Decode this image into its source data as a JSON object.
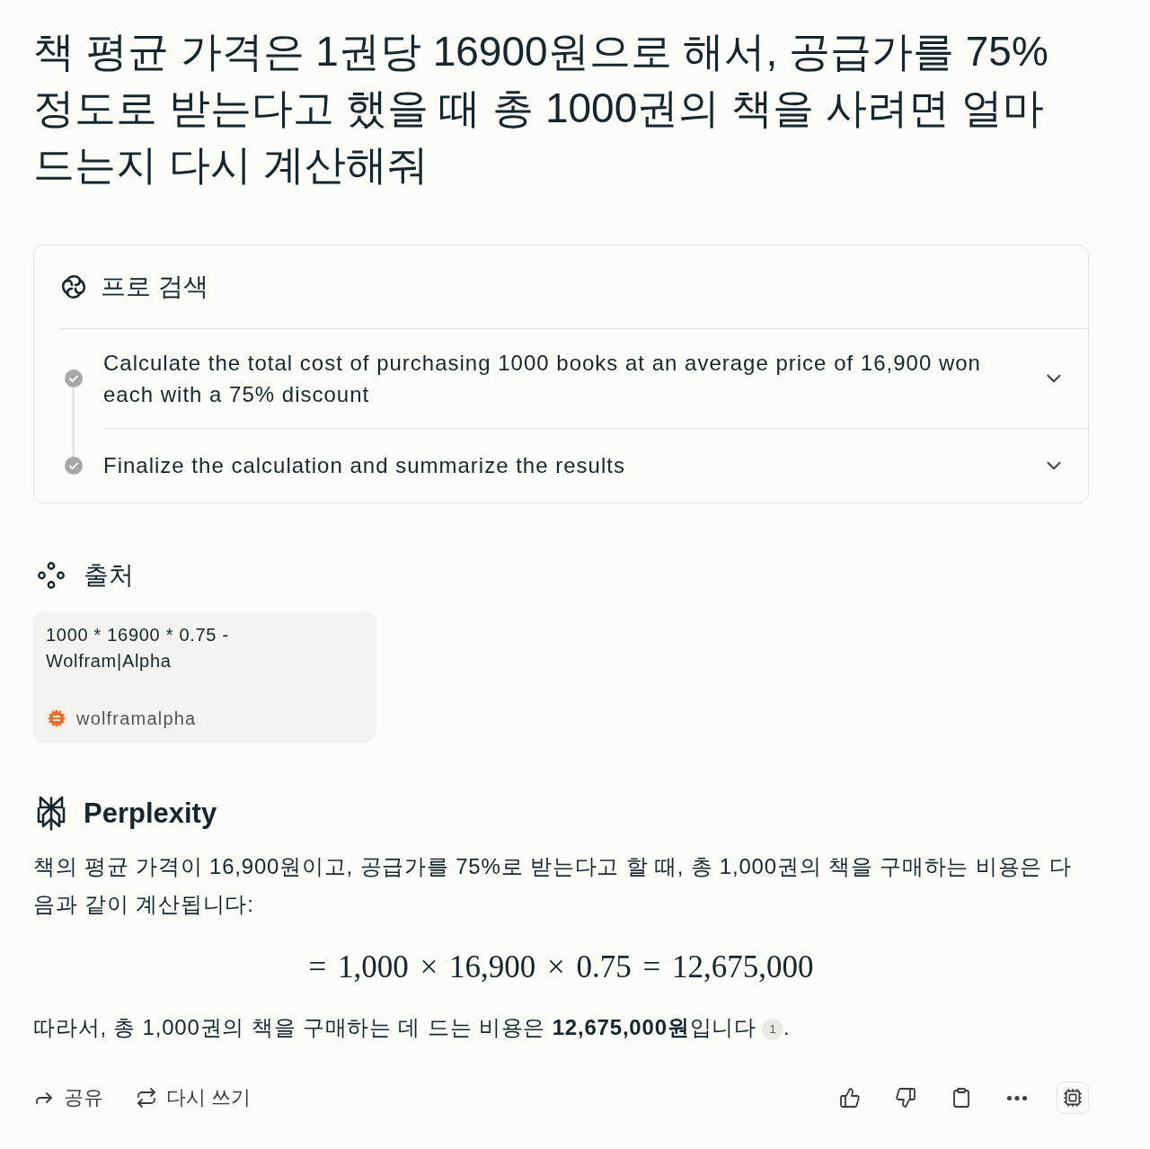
{
  "question": "책 평균 가격은 1권당 16900원으로 해서, 공급가를 75% 정도로 받는다고 했을 때 총 1000권의 책을 사려면 얼마 드는지 다시 계산해줘",
  "pro_search": {
    "title": "프로 검색",
    "steps": [
      {
        "text": "Calculate the total cost of purchasing 1000 books at an average price of 16,900 won each with a 75% discount",
        "completed": true,
        "expanded": false
      },
      {
        "text": "Finalize the calculation and summarize the results",
        "completed": true,
        "expanded": false
      }
    ]
  },
  "sources": {
    "title": "출처",
    "items": [
      {
        "title": "1000 * 16900 * 0.75 - Wolfram|Alpha",
        "site": "wolframalpha"
      }
    ]
  },
  "answer": {
    "brand": "Perplexity",
    "intro": "책의 평균 가격이 16,900원이고, 공급가를 75%로 받는다고 할 때, 총 1,000권의 책을 구매하는 비용은 다음과 같이 계산됩니다:",
    "formula": "= 1,000 × 16,900 × 0.75 = 12,675,000",
    "conclusion": "따라서, 총 1,000권의 책을 구매하는 데 드는 비용은 **12,675,000원**입니다",
    "citation": "1",
    "closing": "."
  },
  "actions": [
    {
      "kind": "share",
      "label": "공유"
    },
    {
      "kind": "rewrite",
      "label": "다시 쓰기"
    }
  ]
}
